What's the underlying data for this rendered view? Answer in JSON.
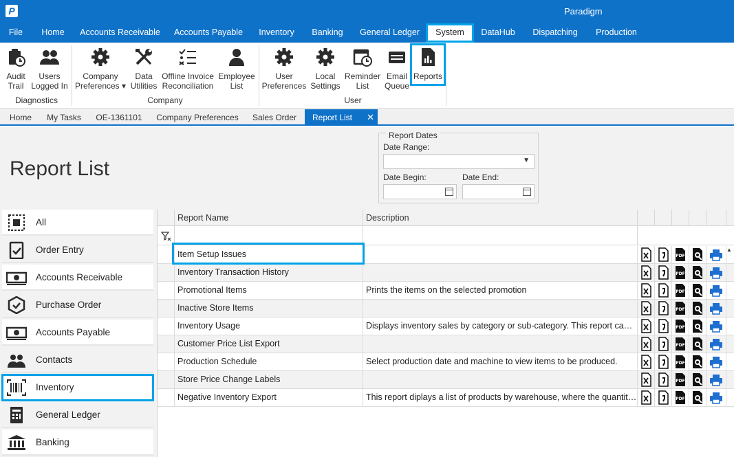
{
  "app": {
    "title": "Paradigm",
    "logo": "P"
  },
  "menu": {
    "items": [
      {
        "label": "File"
      },
      {
        "label": "Home"
      },
      {
        "label": "Accounts Receivable"
      },
      {
        "label": "Accounts Payable"
      },
      {
        "label": "Inventory"
      },
      {
        "label": "Banking"
      },
      {
        "label": "General Ledger"
      },
      {
        "label": "System"
      },
      {
        "label": "DataHub"
      },
      {
        "label": "Dispatching"
      },
      {
        "label": "Production"
      }
    ],
    "active": "System"
  },
  "ribbon": {
    "buttons": [
      {
        "label": "Audit\nTrail",
        "icon": "audit-trail-icon"
      },
      {
        "label": "Users\nLogged In",
        "icon": "users-icon"
      },
      {
        "label": "Company\nPreferences ▾",
        "icon": "gear-icon"
      },
      {
        "label": "Data\nUtilities",
        "icon": "tools-icon"
      },
      {
        "label": "Offline Invoice\nReconciliation",
        "icon": "checklist-icon"
      },
      {
        "label": "Employee\nList",
        "icon": "person-icon"
      },
      {
        "label": "User\nPreferences",
        "icon": "gear-icon"
      },
      {
        "label": "Local\nSettings",
        "icon": "gear-icon"
      },
      {
        "label": "Reminder\nList",
        "icon": "calendar-clock-icon"
      },
      {
        "label": "Email\nQueue",
        "icon": "email-icon"
      },
      {
        "label": "Reports",
        "icon": "report-icon"
      }
    ],
    "groups": [
      {
        "label": "Diagnostics"
      },
      {
        "label": "Company"
      },
      {
        "label": "User"
      }
    ]
  },
  "doc_tabs": [
    {
      "label": "Home"
    },
    {
      "label": "My Tasks"
    },
    {
      "label": "OE-1361101"
    },
    {
      "label": "Company Preferences"
    },
    {
      "label": "Sales Order"
    },
    {
      "label": "Report List",
      "close": "✕"
    }
  ],
  "page": {
    "title": "Report List"
  },
  "report_dates": {
    "legend": "Report Dates",
    "date_range_label": "Date Range:",
    "date_range_value": "",
    "date_begin_label": "Date Begin:",
    "date_begin_value": "",
    "date_end_label": "Date End:",
    "date_end_value": ""
  },
  "categories": [
    {
      "label": "All",
      "icon": "all-icon"
    },
    {
      "label": "Order Entry",
      "icon": "order-entry-icon"
    },
    {
      "label": "Accounts Receivable",
      "icon": "money-icon"
    },
    {
      "label": "Purchase Order",
      "icon": "purchase-order-icon"
    },
    {
      "label": "Accounts Payable",
      "icon": "money-icon"
    },
    {
      "label": "Contacts",
      "icon": "contacts-icon"
    },
    {
      "label": "Inventory",
      "icon": "barcode-icon"
    },
    {
      "label": "General Ledger",
      "icon": "ledger-icon"
    },
    {
      "label": "Banking",
      "icon": "bank-icon"
    }
  ],
  "selected_category": "Inventory",
  "grid": {
    "columns": {
      "name": "Report Name",
      "description": "Description"
    },
    "action_icons": [
      "excel-icon",
      "word-icon",
      "pdf-icon",
      "preview-icon",
      "print-icon"
    ],
    "rows": [
      {
        "name": "Item Setup Issues",
        "description": ""
      },
      {
        "name": "Inventory Transaction History",
        "description": ""
      },
      {
        "name": "Promotional Items",
        "description": "Prints the items on the selected promotion"
      },
      {
        "name": "Inactive Store Items",
        "description": ""
      },
      {
        "name": "Inventory Usage",
        "description": "Displays inventory sales by category or sub-category.  This report can be used to help determine ideal stocking levels."
      },
      {
        "name": "Customer Price List Export",
        "description": ""
      },
      {
        "name": "Production Schedule",
        "description": "Select production date and machine to view items to be produced."
      },
      {
        "name": "Store Price Change Labels",
        "description": ""
      },
      {
        "name": "Negative Inventory Export",
        "description": "This report diplays a list of products by warehouse, where the quantity on hand is negative."
      }
    ]
  },
  "colors": {
    "brand": "#0f72c9",
    "highlight": "#00a2e8"
  }
}
